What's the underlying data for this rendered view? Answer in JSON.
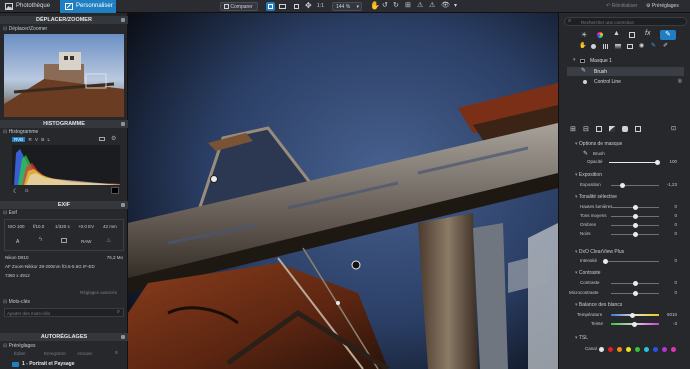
{
  "topbar": {
    "tab_library": "Photothèque",
    "tab_customize": "Personnaliser",
    "compare_label": "Comparer",
    "zoom_fit": "1:1",
    "zoom_level": "144 %",
    "right_correct": "Réinitialiser",
    "right_presets": "Préréglages"
  },
  "left": {
    "navigator_title": "DÉPLACER/ZOOMER",
    "navigator_sub": "Déplacer/Zoomer",
    "histogram_title": "HISTOGRAMME",
    "histogram_sub": "Histogramme",
    "hist_tabs": [
      "RVB",
      "R",
      "V",
      "B",
      "L"
    ],
    "exif_title": "EXIF",
    "exif_sub": "Exif",
    "exif_row1": [
      "ISO 100",
      "f/10.0",
      "1/320 s",
      "+0.0 EV",
      "42 mm"
    ],
    "exif_row2": [
      "A",
      "RAW"
    ],
    "camera": "Nikon D810",
    "filesize": "76,3 Mo",
    "lens": "AF Zoom-Nikkor 28-200mm f/3.5-5.6G IF-ED",
    "dimensions": "7360 x 4912",
    "advanced_settings": "Réglages avancés",
    "keywords_sub": "Mots-clés",
    "keywords_placeholder": "Ajouter des mots-clés",
    "presets_title": "AUTORÉGLAGES",
    "presets_sub": "Préréglages",
    "presets_actions": [
      "Éditer",
      "Enregistrer",
      "Annuler"
    ],
    "preset_item": "1 - Portrait et Paysage"
  },
  "right": {
    "search_placeholder": "Rechercher une correction",
    "mask_name": "Masque 1",
    "brush_name": "Brush",
    "control_line": "Control Line",
    "mask_options_title": "Options de masque",
    "brush_label": "Brush",
    "opacity_label": "Opacité",
    "opacity_value": "100",
    "exposure_group": "Exposition",
    "exposure_label": "Exposition",
    "exposure_value": "-1,23",
    "selective_group": "Tonalité sélective",
    "selective_rows": [
      {
        "label": "Hautes lumières",
        "value": "0"
      },
      {
        "label": "Tons moyens",
        "value": "0"
      },
      {
        "label": "Ombres",
        "value": "0"
      },
      {
        "label": "Noirs",
        "value": "0"
      }
    ],
    "clearview_group": "DxO ClearView Plus",
    "intensity_label": "Intensité",
    "intensity_value": "0",
    "contrast_group": "Contraste",
    "contrast_label": "Contraste",
    "contrast_value": "0",
    "microcontrast_label": "Microcontraste",
    "microcontrast_value": "0",
    "wb_group": "Balance des blancs",
    "temperature_label": "Température",
    "temperature_value": "5010",
    "tint_label": "Teinte",
    "tint_value": "-3",
    "tsl_group": "TSL",
    "color_label": "Canal",
    "color_swatches": [
      "#e5e5e5",
      "#e02020",
      "#f08a1c",
      "#f2e11f",
      "#35c43b",
      "#21c6d9",
      "#2a52e8",
      "#b335e0",
      "#e234b4"
    ]
  },
  "accent": "#1f7fc2"
}
